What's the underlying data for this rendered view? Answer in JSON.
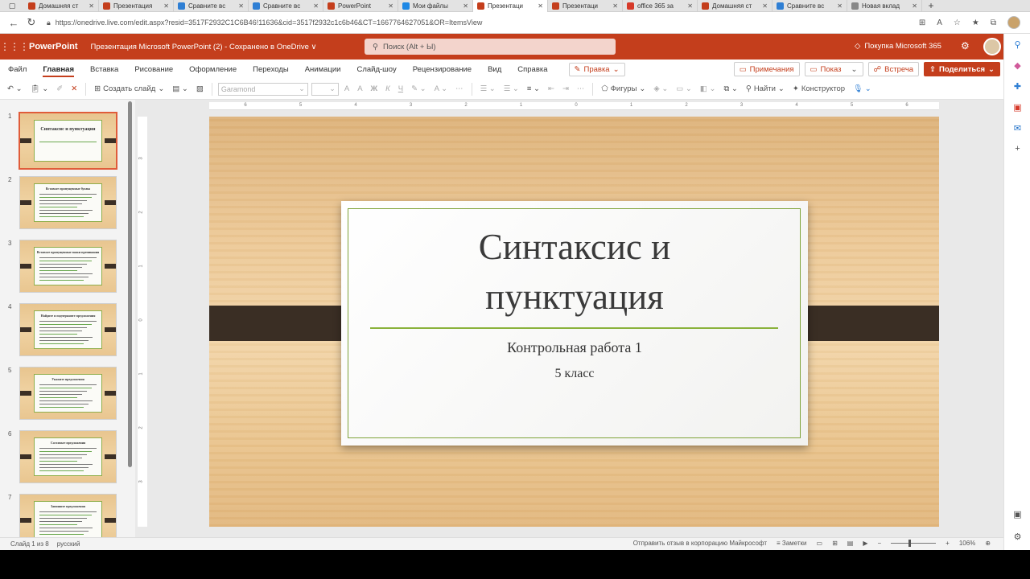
{
  "browser": {
    "tabs": [
      {
        "title": "Домашняя ст",
        "fav_color": "#c43e1c",
        "active": false
      },
      {
        "title": "Презентация",
        "fav_color": "#c43e1c",
        "active": false
      },
      {
        "title": "Сравните вс",
        "fav_color": "#2f7fd4",
        "active": false
      },
      {
        "title": "Сравните вс",
        "fav_color": "#2f7fd4",
        "active": false
      },
      {
        "title": "PowerPoint",
        "fav_color": "#c43e1c",
        "active": false
      },
      {
        "title": "Мои файлы",
        "fav_color": "#1e88e5",
        "active": false
      },
      {
        "title": "Презентаци",
        "fav_color": "#c43e1c",
        "active": true
      },
      {
        "title": "Презентаци",
        "fav_color": "#c43e1c",
        "active": false
      },
      {
        "title": "office 365 за",
        "fav_color": "#d63a2a",
        "active": false
      },
      {
        "title": "Домашняя ст",
        "fav_color": "#c43e1c",
        "active": false
      },
      {
        "title": "Сравните вс",
        "fav_color": "#2f7fd4",
        "active": false
      },
      {
        "title": "Новая вклад",
        "fav_color": "#888888",
        "active": false
      }
    ],
    "url": "https://onedrive.live.com/edit.aspx?resid=3517F2932C1C6B46!11636&cid=3517f2932c1c6b46&CT=1667764627051&OR=ItemsView"
  },
  "header": {
    "app_name": "PowerPoint",
    "doc_name": "Презентация Microsoft PowerPoint (2)  -  Сохранено в OneDrive ∨",
    "search_placeholder": "Поиск (Alt + Ы)",
    "buy_label": "Покупка Microsoft 365"
  },
  "ribbon": {
    "tabs": [
      "Файл",
      "Главная",
      "Вставка",
      "Рисование",
      "Оформление",
      "Переходы",
      "Анимации",
      "Слайд-шоу",
      "Рецензирование",
      "Вид",
      "Справка"
    ],
    "active_tab": "Главная",
    "edit_mode": "Правка",
    "comments": "Примечания",
    "present": "Показ",
    "meeting": "Встреча",
    "share": "Поделиться"
  },
  "toolbar": {
    "new_slide": "Создать слайд",
    "font": "Garamond",
    "shapes": "Фигуры",
    "find": "Найти",
    "designer": "Конструктор"
  },
  "thumbnails": [
    {
      "num": "1",
      "title": "Синтаксис и пунктуация"
    },
    {
      "num": "2",
      "title": "Вставьте пропущенные буквы"
    },
    {
      "num": "3",
      "title": "Вставьте пропущенные знаки препинания"
    },
    {
      "num": "4",
      "title": "Найдите и подчеркните предложения"
    },
    {
      "num": "5",
      "title": "Укажите предложения"
    },
    {
      "num": "6",
      "title": "Составьте предложения"
    },
    {
      "num": "7",
      "title": "Запишите предложения"
    }
  ],
  "slide": {
    "title_line1": "Синтаксис и",
    "title_line2": "пунктуация",
    "subtitle1": "Контрольная работа 1",
    "subtitle2": "5 класс"
  },
  "ruler_h": [
    "6",
    "5",
    "4",
    "3",
    "2",
    "1",
    "0",
    "1",
    "2",
    "3",
    "4",
    "5",
    "6"
  ],
  "ruler_v": [
    "3",
    "2",
    "1",
    "0",
    "1",
    "2",
    "3"
  ],
  "status": {
    "slide_info": "Слайд 1 из 8",
    "language": "русский",
    "feedback": "Отправить отзыв в корпорацию Майкрософт",
    "notes": "Заметки",
    "zoom": "106%"
  },
  "colors": {
    "accent": "#c43e1c",
    "slide_frame": "#7fa33a",
    "band": "#3a2e24"
  }
}
